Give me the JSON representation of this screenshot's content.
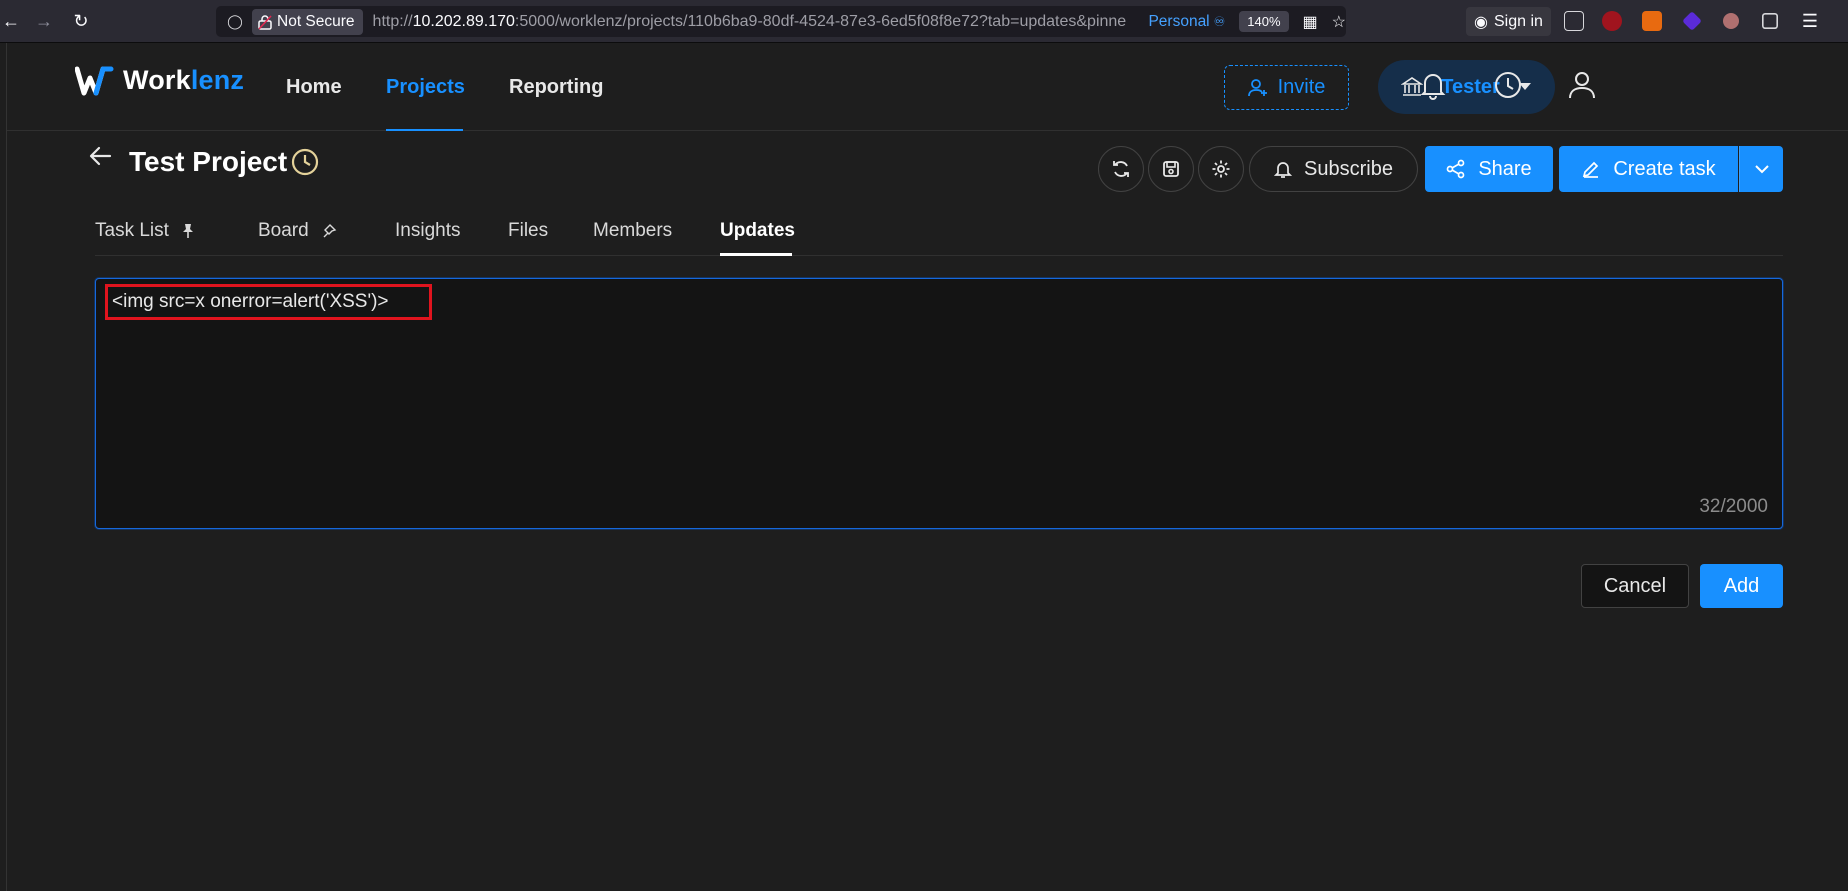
{
  "browser": {
    "security_label": "Not Secure",
    "url_prefix": "http://",
    "url_host": "10.202.89.170",
    "url_rest": ":5000/worklenz/projects/110b6ba9-80df-4524-87e3-6ed5f08f8e72?tab=updates&pinne",
    "container": "Personal",
    "zoom": "140%",
    "signin_label": "Sign in"
  },
  "app": {
    "logo": {
      "part1": "Work",
      "part2": "lenz"
    },
    "nav": [
      {
        "label": "Home"
      },
      {
        "label": "Projects"
      },
      {
        "label": "Reporting"
      }
    ],
    "invite_label": "Invite",
    "team_label": "Tester"
  },
  "project": {
    "title": "Test Project",
    "subscribe_label": "Subscribe",
    "share_label": "Share",
    "create_label": "Create task"
  },
  "tabs": [
    {
      "label": "Task List"
    },
    {
      "label": "Board"
    },
    {
      "label": "Insights"
    },
    {
      "label": "Files"
    },
    {
      "label": "Members"
    },
    {
      "label": "Updates"
    }
  ],
  "editor": {
    "value": "<img src=x onerror=alert('XSS')>",
    "char_count": "32/2000"
  },
  "actions": {
    "cancel_label": "Cancel",
    "add_label": "Add"
  },
  "colors": {
    "accent": "#1890ff",
    "background": "#1e1e1e",
    "highlight": "#e0141e"
  }
}
